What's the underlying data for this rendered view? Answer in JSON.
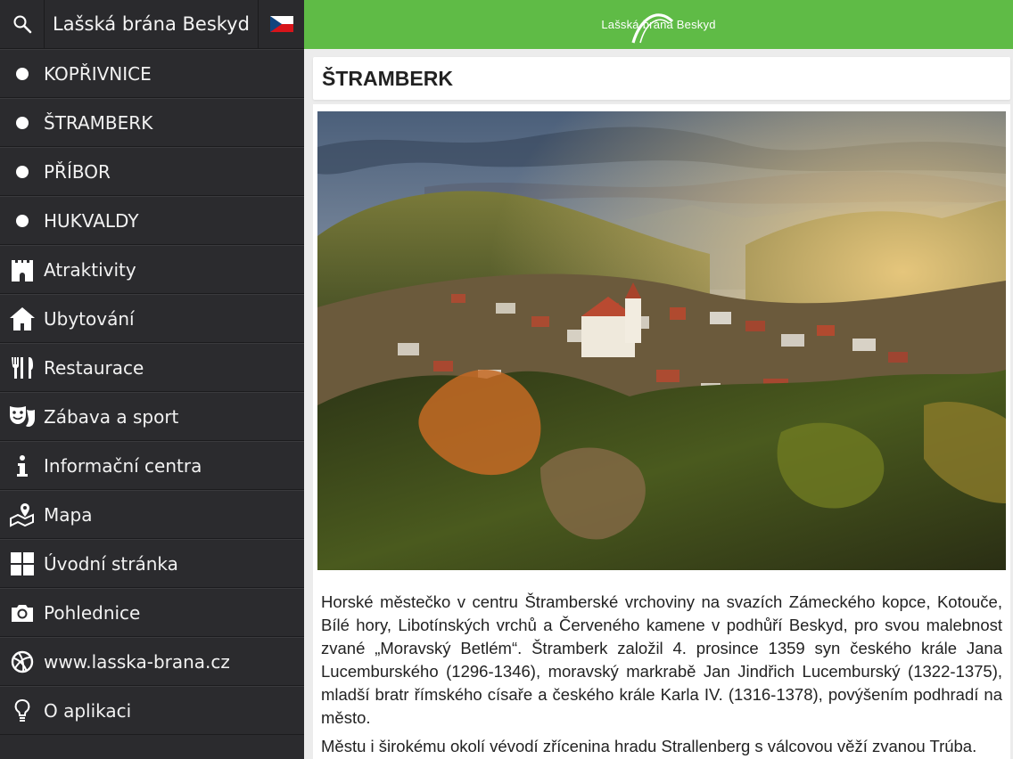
{
  "sidebar": {
    "header": {
      "title": "Lašská brána Beskyd",
      "search_icon": "search-icon",
      "language_icon": "czech-flag-icon"
    },
    "items": [
      {
        "label": "KOPŘIVNICE",
        "icon": "bullet-icon"
      },
      {
        "label": "ŠTRAMBERK",
        "icon": "bullet-icon"
      },
      {
        "label": "PŘÍBOR",
        "icon": "bullet-icon"
      },
      {
        "label": "HUKVALDY",
        "icon": "bullet-icon"
      },
      {
        "label": "Atraktivity",
        "icon": "castle-icon"
      },
      {
        "label": "Ubytování",
        "icon": "house-icon"
      },
      {
        "label": "Restaurace",
        "icon": "cutlery-icon"
      },
      {
        "label": "Zábava a sport",
        "icon": "theater-masks-icon"
      },
      {
        "label": "Informační centra",
        "icon": "info-icon"
      },
      {
        "label": "Mapa",
        "icon": "map-pin-icon"
      },
      {
        "label": "Úvodní stránka",
        "icon": "grid-icon"
      },
      {
        "label": "Pohlednice",
        "icon": "camera-icon"
      },
      {
        "label": "www.lasska-brana.cz",
        "icon": "globe-icon"
      },
      {
        "label": "O aplikaci",
        "icon": "lightbulb-icon"
      }
    ]
  },
  "topbar": {
    "logo_text_1": "Lašská",
    "logo_text_2": "brána Beskyd",
    "color": "#5fbb46"
  },
  "article": {
    "title": "ŠTRAMBERK",
    "paragraphs": [
      "Horské městečko v centru Štramberské vrchoviny na svazích Zámeckého kopce, Kotouče, Bílé hory, Libotínských vrchů a Červeného kamene v podhůří Beskyd, pro svou malebnost zvané „Moravský Betlém“. Štramberk založil 4. prosince 1359 syn českého krále Jana Lucemburského (1296-1346), moravský markrabě Jan Jindřich Lucemburský (1322-1375), mladší bratr římského císaře a českého krále Karla IV. (1316-1378), povýšením podhradí na město.",
      "Městu i širokému okolí vévodí zřícenina hradu Strallenberg s válcovou věží zvanou Trúba."
    ]
  }
}
